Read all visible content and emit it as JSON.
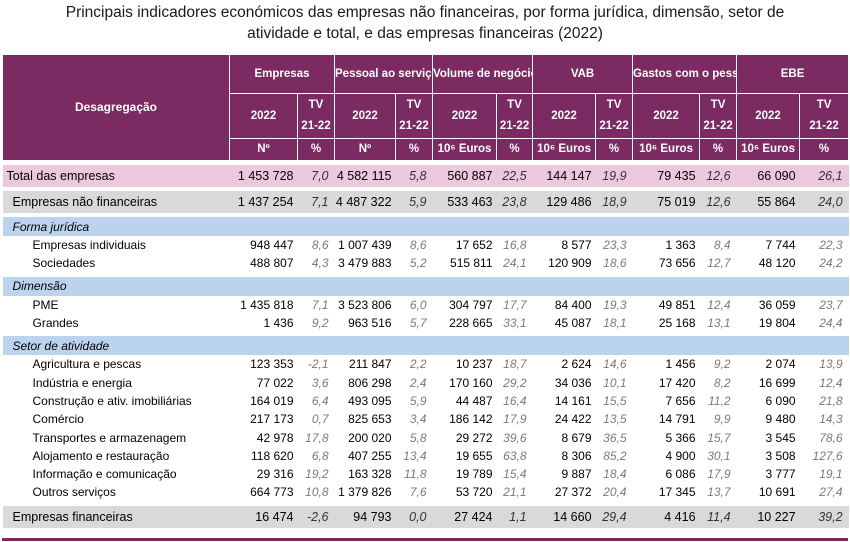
{
  "title": {
    "line1": "Principais indicadores económicos das empresas não financeiras, por forma jurídica, dimensão, setor de",
    "line2": "atividade e total, e das empresas financeiras (2022)"
  },
  "header": {
    "desagregacao": "Desagregação",
    "groups": [
      "Empresas",
      "Pessoal ao serviço",
      "Volume de negócios",
      "VAB",
      "Gastos com o pessoal",
      "EBE"
    ],
    "year": "2022",
    "tv_top": "TV",
    "tv_bottom": "21-22",
    "units": [
      "Nº",
      "Nº",
      "10⁶ Euros",
      "10⁶ Euros",
      "10⁶ Euros",
      "10⁶ Euros"
    ],
    "pct": "%"
  },
  "rows": {
    "total": {
      "label": "Total das empresas",
      "v": [
        "1 453 728",
        "7,0",
        "4 582 115",
        "5,8",
        "560 887",
        "22,5",
        "144 147",
        "19,9",
        "79 435",
        "12,6",
        "66 090",
        "26,1"
      ]
    },
    "nfin": {
      "label": "Empresas não financeiras",
      "v": [
        "1 437 254",
        "7,1",
        "4 487 322",
        "5,9",
        "533 463",
        "23,8",
        "129 486",
        "18,9",
        "75 019",
        "12,6",
        "55 864",
        "24,0"
      ]
    },
    "sec_forma": "Forma jurídica",
    "individuais": {
      "label": "Empresas individuais",
      "v": [
        "948 447",
        "8,6",
        "1 007 439",
        "8,6",
        "17 652",
        "16,8",
        "8 577",
        "23,3",
        "1 363",
        "8,4",
        "7 744",
        "22,3"
      ]
    },
    "sociedades": {
      "label": "Sociedades",
      "v": [
        "488 807",
        "4,3",
        "3 479 883",
        "5,2",
        "515 811",
        "24,1",
        "120 909",
        "18,6",
        "73 656",
        "12,7",
        "48 120",
        "24,2"
      ]
    },
    "sec_dim": "Dimensão",
    "pme": {
      "label": "PME",
      "v": [
        "1 435 818",
        "7,1",
        "3 523 806",
        "6,0",
        "304 797",
        "17,7",
        "84 400",
        "19,3",
        "49 851",
        "12,4",
        "36 059",
        "23,7"
      ]
    },
    "grandes": {
      "label": "Grandes",
      "v": [
        "1 436",
        "9,2",
        "963 516",
        "5,7",
        "228 665",
        "33,1",
        "45 087",
        "18,1",
        "25 168",
        "13,1",
        "19 804",
        "24,4"
      ]
    },
    "sec_setor": "Setor de atividade",
    "agricultura": {
      "label": "Agricultura e pescas",
      "v": [
        "123 353",
        "-2,1",
        "211 847",
        "2,2",
        "10 237",
        "18,7",
        "2 624",
        "14,6",
        "1 456",
        "9,2",
        "2 074",
        "13,9"
      ]
    },
    "industria": {
      "label": "Indústria e energia",
      "v": [
        "77 022",
        "3,6",
        "806 298",
        "2,4",
        "170 160",
        "29,2",
        "34 036",
        "10,1",
        "17 420",
        "8,2",
        "16 699",
        "12,4"
      ]
    },
    "construcao": {
      "label": "Construção e ativ. imobiliárias",
      "v": [
        "164 019",
        "6,4",
        "493 095",
        "5,9",
        "44 487",
        "16,4",
        "14 161",
        "15,5",
        "7 656",
        "11,2",
        "6 090",
        "21,8"
      ]
    },
    "comercio": {
      "label": "Comércio",
      "v": [
        "217 173",
        "0,7",
        "825 653",
        "3,4",
        "186 142",
        "17,9",
        "24 422",
        "13,5",
        "14 791",
        "9,9",
        "9 480",
        "14,3"
      ]
    },
    "transportes": {
      "label": "Transportes e armazenagem",
      "v": [
        "42 978",
        "17,8",
        "200 020",
        "5,8",
        "29 272",
        "39,6",
        "8 679",
        "36,5",
        "5 366",
        "15,7",
        "3 545",
        "78,6"
      ]
    },
    "alojamento": {
      "label": "Alojamento e restauração",
      "v": [
        "118 620",
        "6,8",
        "407 255",
        "13,4",
        "19 655",
        "63,8",
        "8 306",
        "85,2",
        "4 900",
        "30,1",
        "3 508",
        "127,6"
      ]
    },
    "informacao": {
      "label": "Informação e comunicação",
      "v": [
        "29 316",
        "19,2",
        "163 328",
        "11,8",
        "19 789",
        "15,4",
        "9 887",
        "18,4",
        "6 086",
        "17,9",
        "3 777",
        "19,1"
      ]
    },
    "outros": {
      "label": "Outros serviços",
      "v": [
        "664 773",
        "10,8",
        "1 379 826",
        "7,6",
        "53 720",
        "21,1",
        "27 372",
        "20,4",
        "17 345",
        "13,7",
        "10 691",
        "27,4"
      ]
    },
    "fin": {
      "label": "Empresas financeiras",
      "v": [
        "16 474",
        "-2,6",
        "94 793",
        "0,0",
        "27 424",
        "1,1",
        "14 660",
        "29,4",
        "4 416",
        "11,4",
        "10 227",
        "39,2"
      ]
    }
  }
}
